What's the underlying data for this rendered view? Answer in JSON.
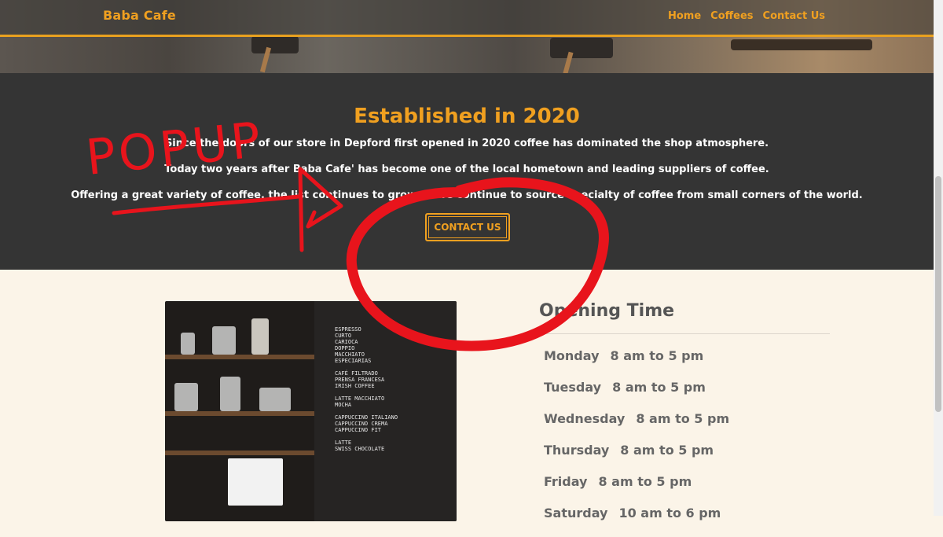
{
  "brand": "Baba Cafe",
  "nav": {
    "home": "Home",
    "coffees": "Coffees",
    "contact": "Contact Us"
  },
  "about": {
    "title": "Established in 2020",
    "line1": "Since the doors of our store in Depford first opened in 2020 coffee has dominated the shop atmosphere.",
    "line2": "Today two years after Baba Cafe' has become one of the local hometown and leading suppliers of coffee.",
    "line3": "Offering a great variety of coffee, the list continues to grow as we continue to source specialty of coffee from small corners of the world.",
    "button": "CONTACT US"
  },
  "hours": {
    "title": "Opening Time",
    "days": [
      {
        "day": "Monday",
        "time": "8 am to 5 pm"
      },
      {
        "day": "Tuesday",
        "time": "8 am to 5 pm"
      },
      {
        "day": "Wednesday",
        "time": "8 am to 5 pm"
      },
      {
        "day": "Thursday",
        "time": "8 am to 5 pm"
      },
      {
        "day": "Friday",
        "time": "8 am to 5 pm"
      },
      {
        "day": "Saturday",
        "time": "10 am to 6 pm"
      }
    ]
  },
  "annotation": {
    "text": "POPUP",
    "color": "#e8141c"
  },
  "colors": {
    "accent": "#f0a020",
    "dark": "#343434",
    "cream": "#fbf4e8"
  }
}
